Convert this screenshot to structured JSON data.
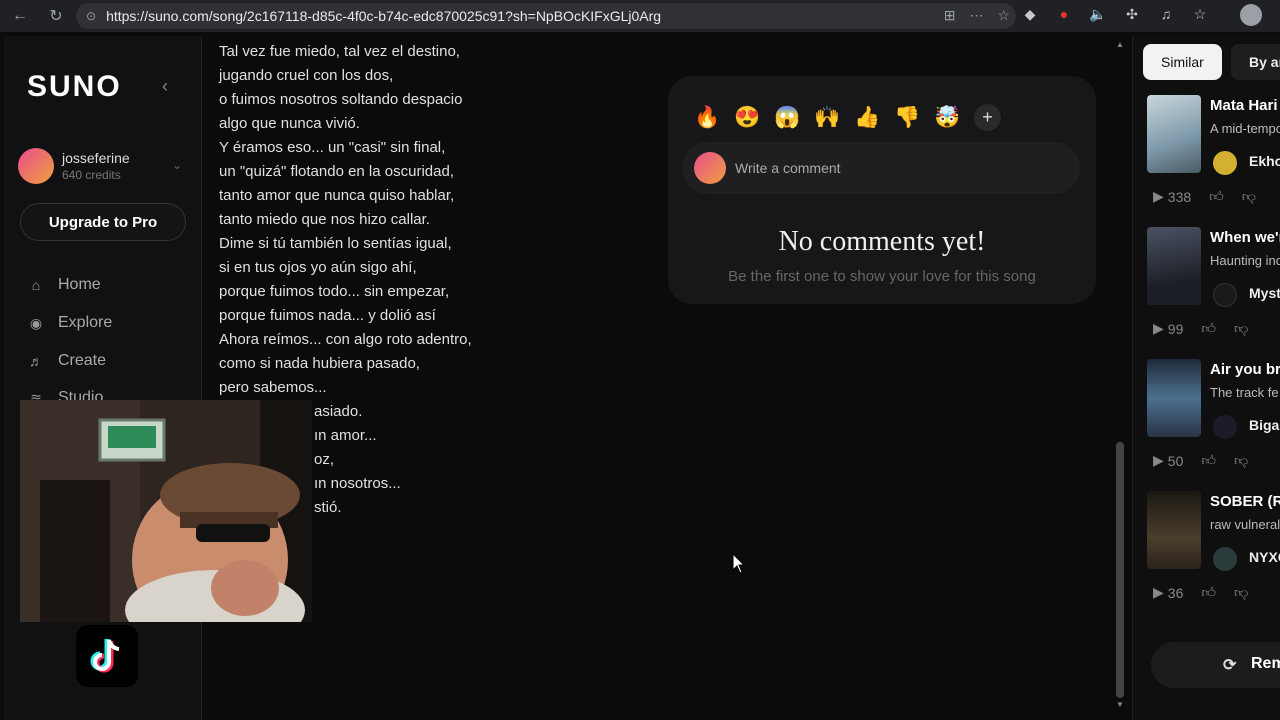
{
  "browser": {
    "url": "https://suno.com/song/2c167118-d85c-4f0c-b74c-edc870025c91?sh=NpBOcKIFxGLj0Arg"
  },
  "sidebar": {
    "logo": "SUNO",
    "user": {
      "name": "josseferine",
      "credits": "640 credits"
    },
    "upgrade_label": "Upgrade to Pro",
    "nav": [
      {
        "label": "Home",
        "icon": "home-icon"
      },
      {
        "label": "Explore",
        "icon": "compass-icon"
      },
      {
        "label": "Create",
        "icon": "music-note-icon"
      },
      {
        "label": "Studio",
        "icon": "studio-icon"
      }
    ]
  },
  "lyrics": {
    "lines": [
      "Tal vez fue miedo, tal vez el destino,",
      "jugando cruel con los dos,",
      "o fuimos nosotros soltando despacio",
      "algo que nunca vivió.",
      "Y éramos eso... un \"casi\" sin final,",
      "un \"quizá\" flotando en la oscuridad,",
      "tanto amor que nunca quiso hablar,",
      "tanto miedo que nos hizo callar.",
      "Dime si tú también lo sentías igual,",
      "si en tus ojos yo aún sigo ahí,",
      "porque fuimos todo... sin empezar,",
      "porque fuimos nada... y dolió así",
      "Ahora reímos... con algo roto adentro,",
      "como si nada hubiera pasado,",
      "pero sabemos...",
      "asiado.",
      "ın amor...",
      "oz,",
      "ın nosotros...",
      "stió."
    ]
  },
  "comments": {
    "reactions": [
      "🔥",
      "😍",
      "😱",
      "🙌",
      "👍",
      "👎",
      "🤯"
    ],
    "add_reaction": "+",
    "placeholder": "Write a comment",
    "empty_title": "No comments yet!",
    "empty_subtitle": "Be the first one to show your love for this song"
  },
  "right_panel": {
    "tabs": [
      "Similar",
      "By ar"
    ],
    "songs": [
      {
        "title": "Mata Hari",
        "desc": "A mid-tempo",
        "artist": "Ekho",
        "plays": "338",
        "thumb_color": "#8aa4b0",
        "artist_color": "#d4b030"
      },
      {
        "title": "When we'r",
        "desc": "Haunting ind",
        "artist": "Myst",
        "plays": "99",
        "thumb_color": "#2a2e38",
        "artist_color": "#222"
      },
      {
        "title": "Air you bre",
        "desc": "The track fe",
        "artist": "Bigal",
        "plays": "50",
        "thumb_color": "#3a5a78",
        "artist_color": "#1b1b2a"
      },
      {
        "title": "SOBER (R",
        "desc": "raw vulneral",
        "artist": "NYXC",
        "plays": "36",
        "thumb_color": "#3a3226",
        "artist_color": "#2b3a3a"
      }
    ],
    "remix_label": "Remi"
  }
}
